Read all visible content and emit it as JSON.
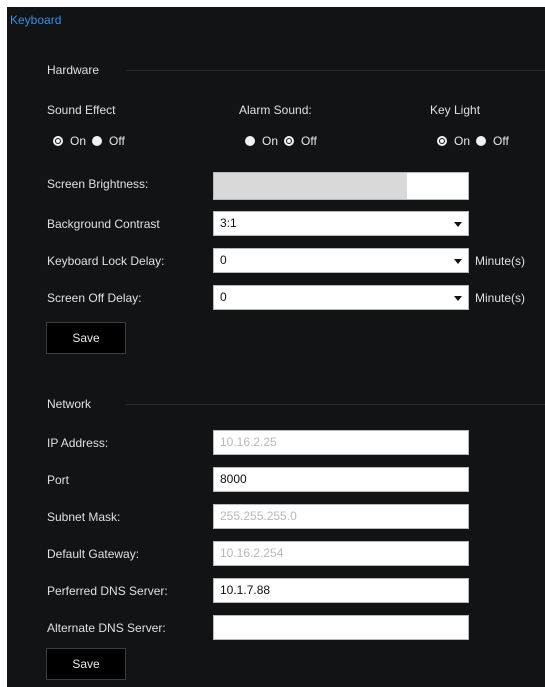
{
  "panel": {
    "title": "Keyboard"
  },
  "hardware": {
    "title": "Hardware",
    "sound_effect": {
      "label": "Sound Effect",
      "on": "On",
      "off": "Off",
      "selected": "On"
    },
    "alarm_sound": {
      "label": "Alarm Sound:",
      "on": "On",
      "off": "Off",
      "selected": "Off"
    },
    "key_light": {
      "label": "Key Light",
      "on": "On",
      "off": "Off",
      "selected": "On"
    },
    "screen_brightness": {
      "label": "Screen Brightness:",
      "level_fraction": 0.76
    },
    "background_contrast": {
      "label": "Background Contrast",
      "value": "3:1"
    },
    "keyboard_lock_delay": {
      "label": "Keyboard Lock Delay:",
      "value": "0",
      "unit": "Minute(s)"
    },
    "screen_off_delay": {
      "label": "Screen Off Delay:",
      "value": "0",
      "unit": "Minute(s)"
    },
    "save_label": "Save"
  },
  "network": {
    "title": "Network",
    "ip_address": {
      "label": "IP Address:",
      "value": "10.16.2.25"
    },
    "port": {
      "label": "Port",
      "value": "8000"
    },
    "subnet_mask": {
      "label": "Subnet Mask:",
      "value": "255.255.255.0"
    },
    "default_gateway": {
      "label": "Default Gateway:",
      "value": "10.16.2.254"
    },
    "preferred_dns": {
      "label": "Perferred DNS Server:",
      "value": "10.1.7.88"
    },
    "alternate_dns": {
      "label": "Alternate DNS Server:",
      "value": ""
    },
    "save_label": "Save"
  },
  "colors": {
    "panel_bg": "#121314",
    "title_accent": "#3a8ee6",
    "field_bg": "#ffffff",
    "button_bg": "#000000"
  }
}
